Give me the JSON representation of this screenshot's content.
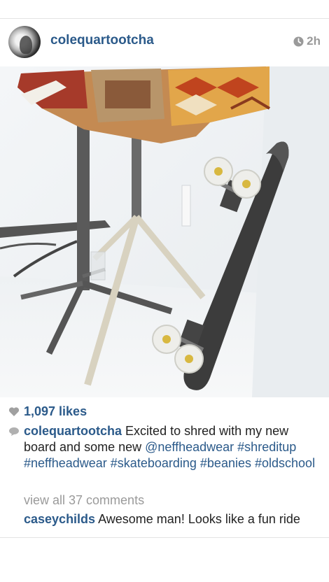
{
  "post": {
    "username": "colequartootcha",
    "time": "2h",
    "likes": "1,097 likes",
    "caption": {
      "user": "colequartootcha",
      "text_1": "Excited to shred with my new board and some new",
      "mention": "@neffheadwear",
      "hashtags": [
        "#shreditup",
        "#neffheadwear",
        "#skateboarding",
        "#beanies",
        "#oldschool"
      ]
    },
    "view_all": "view all 37  comments",
    "comment": {
      "user": "caseychilds",
      "text": "Awesome man! Looks like a fun ride"
    }
  },
  "icons": {
    "clock": "clock-icon",
    "heart": "heart-icon",
    "comment": "comment-bubble-icon"
  },
  "colors": {
    "link": "#2b5a8a",
    "muted": "#9a9a9a"
  }
}
